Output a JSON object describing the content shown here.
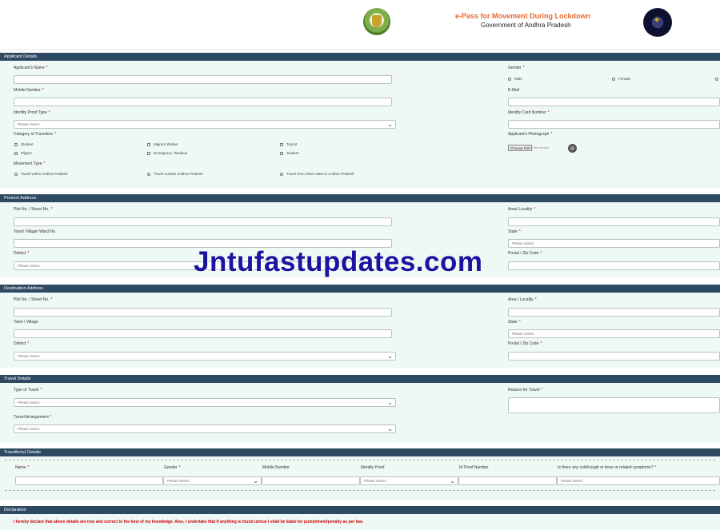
{
  "header": {
    "title": "e-Pass for Movement During Lockdown",
    "subtitle": "Government of Andhra Pradesh",
    "emblem_icon": "andhra-pradesh-emblem-icon",
    "police_icon": "ap-police-logo-icon",
    "accent": "#e8692e"
  },
  "colors": {
    "section_header": "#2e4a63",
    "form_bg": "#eef8f4",
    "watermark": "#1a14a0"
  },
  "watermark": "Jntufastupdates.com",
  "required_mark": "*",
  "applicant": {
    "title": "Applicant Details",
    "name_label": "Applicant's Name",
    "gender_label": "Gender",
    "gender_options": [
      "Male",
      "Female"
    ],
    "mobile_label": "Mobile Number",
    "email_label": "E-Mail",
    "id_proof_type_label": "Identity Proof Type",
    "id_proof_type_value": "Please Select",
    "id_card_label": "Identity Card Number",
    "category_label": "Category of Travellers",
    "categories": [
      "Student",
      "Migrant Worker",
      "Tourist",
      "Pilgrim",
      "Emergency / Medical",
      "Student"
    ],
    "photo_label": "Applicant's Photograph",
    "choose_file": "Choose File",
    "no_file": "No file chosen",
    "movement_label": "Movement Type",
    "movement_options": [
      "Travel within Andhra Pradesh",
      "Travel outside Andhra Pradesh",
      "Travel from Other state to Andhra Pradesh"
    ]
  },
  "present": {
    "title": "Present Address",
    "plot_label": "Plot No. / Street No.",
    "area_label": "Area/ Locality",
    "town_label": "Town/ Village/ Ward No.",
    "state_label": "State",
    "state_value": "Please Select",
    "district_label": "District",
    "district_value": "Please Select",
    "postal_label": "Postal / Zip Code"
  },
  "destination": {
    "title": "Destination Address",
    "plot_label": "Plot No. / Street No.",
    "area_label": "Area / Locality",
    "town_label": "Town / Village",
    "state_label": "State",
    "state_value": "Please Select",
    "district_label": "District",
    "district_value": "Please Select",
    "postal_label": "Postal / Zip Code"
  },
  "travel": {
    "title": "Travel Details",
    "type_label": "Type of Travel",
    "type_value": "Please Select",
    "reason_label": "Reason for Travel",
    "arrangement_label": "Travel Arrangement",
    "arrangement_value": "Please Select"
  },
  "travellers": {
    "title": "Traveller(s) Details",
    "columns": [
      "Name",
      "Gender",
      "Mobile Number",
      "Identity Proof",
      "Id Proof Number",
      "Is there any cold/cough or fever or related symptoms?"
    ],
    "gender_value": "Please Select",
    "id_proof_value": "Please Select",
    "symptoms_value": "Please Select"
  },
  "declaration": {
    "title": "Declaration",
    "text": "I hereby declare that above details are true and correct to the best of my knowledge. Also, I undertake that if anything is found untrue I shall be liable for punishment/penalty as per law."
  }
}
